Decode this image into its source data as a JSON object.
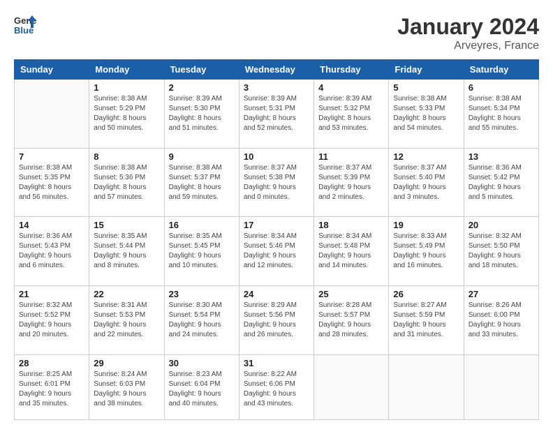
{
  "header": {
    "logo_line1": "General",
    "logo_line2": "Blue",
    "month_title": "January 2024",
    "location": "Arveyres, France"
  },
  "days_of_week": [
    "Sunday",
    "Monday",
    "Tuesday",
    "Wednesday",
    "Thursday",
    "Friday",
    "Saturday"
  ],
  "weeks": [
    [
      {
        "day": "",
        "info": ""
      },
      {
        "day": "1",
        "info": "Sunrise: 8:38 AM\nSunset: 5:29 PM\nDaylight: 8 hours\nand 50 minutes."
      },
      {
        "day": "2",
        "info": "Sunrise: 8:39 AM\nSunset: 5:30 PM\nDaylight: 8 hours\nand 51 minutes."
      },
      {
        "day": "3",
        "info": "Sunrise: 8:39 AM\nSunset: 5:31 PM\nDaylight: 8 hours\nand 52 minutes."
      },
      {
        "day": "4",
        "info": "Sunrise: 8:39 AM\nSunset: 5:32 PM\nDaylight: 8 hours\nand 53 minutes."
      },
      {
        "day": "5",
        "info": "Sunrise: 8:38 AM\nSunset: 5:33 PM\nDaylight: 8 hours\nand 54 minutes."
      },
      {
        "day": "6",
        "info": "Sunrise: 8:38 AM\nSunset: 5:34 PM\nDaylight: 8 hours\nand 55 minutes."
      }
    ],
    [
      {
        "day": "7",
        "info": "Sunrise: 8:38 AM\nSunset: 5:35 PM\nDaylight: 8 hours\nand 56 minutes."
      },
      {
        "day": "8",
        "info": "Sunrise: 8:38 AM\nSunset: 5:36 PM\nDaylight: 8 hours\nand 57 minutes."
      },
      {
        "day": "9",
        "info": "Sunrise: 8:38 AM\nSunset: 5:37 PM\nDaylight: 8 hours\nand 59 minutes."
      },
      {
        "day": "10",
        "info": "Sunrise: 8:37 AM\nSunset: 5:38 PM\nDaylight: 9 hours\nand 0 minutes."
      },
      {
        "day": "11",
        "info": "Sunrise: 8:37 AM\nSunset: 5:39 PM\nDaylight: 9 hours\nand 2 minutes."
      },
      {
        "day": "12",
        "info": "Sunrise: 8:37 AM\nSunset: 5:40 PM\nDaylight: 9 hours\nand 3 minutes."
      },
      {
        "day": "13",
        "info": "Sunrise: 8:36 AM\nSunset: 5:42 PM\nDaylight: 9 hours\nand 5 minutes."
      }
    ],
    [
      {
        "day": "14",
        "info": "Sunrise: 8:36 AM\nSunset: 5:43 PM\nDaylight: 9 hours\nand 6 minutes."
      },
      {
        "day": "15",
        "info": "Sunrise: 8:35 AM\nSunset: 5:44 PM\nDaylight: 9 hours\nand 8 minutes."
      },
      {
        "day": "16",
        "info": "Sunrise: 8:35 AM\nSunset: 5:45 PM\nDaylight: 9 hours\nand 10 minutes."
      },
      {
        "day": "17",
        "info": "Sunrise: 8:34 AM\nSunset: 5:46 PM\nDaylight: 9 hours\nand 12 minutes."
      },
      {
        "day": "18",
        "info": "Sunrise: 8:34 AM\nSunset: 5:48 PM\nDaylight: 9 hours\nand 14 minutes."
      },
      {
        "day": "19",
        "info": "Sunrise: 8:33 AM\nSunset: 5:49 PM\nDaylight: 9 hours\nand 16 minutes."
      },
      {
        "day": "20",
        "info": "Sunrise: 8:32 AM\nSunset: 5:50 PM\nDaylight: 9 hours\nand 18 minutes."
      }
    ],
    [
      {
        "day": "21",
        "info": "Sunrise: 8:32 AM\nSunset: 5:52 PM\nDaylight: 9 hours\nand 20 minutes."
      },
      {
        "day": "22",
        "info": "Sunrise: 8:31 AM\nSunset: 5:53 PM\nDaylight: 9 hours\nand 22 minutes."
      },
      {
        "day": "23",
        "info": "Sunrise: 8:30 AM\nSunset: 5:54 PM\nDaylight: 9 hours\nand 24 minutes."
      },
      {
        "day": "24",
        "info": "Sunrise: 8:29 AM\nSunset: 5:56 PM\nDaylight: 9 hours\nand 26 minutes."
      },
      {
        "day": "25",
        "info": "Sunrise: 8:28 AM\nSunset: 5:57 PM\nDaylight: 9 hours\nand 28 minutes."
      },
      {
        "day": "26",
        "info": "Sunrise: 8:27 AM\nSunset: 5:59 PM\nDaylight: 9 hours\nand 31 minutes."
      },
      {
        "day": "27",
        "info": "Sunrise: 8:26 AM\nSunset: 6:00 PM\nDaylight: 9 hours\nand 33 minutes."
      }
    ],
    [
      {
        "day": "28",
        "info": "Sunrise: 8:25 AM\nSunset: 6:01 PM\nDaylight: 9 hours\nand 35 minutes."
      },
      {
        "day": "29",
        "info": "Sunrise: 8:24 AM\nSunset: 6:03 PM\nDaylight: 9 hours\nand 38 minutes."
      },
      {
        "day": "30",
        "info": "Sunrise: 8:23 AM\nSunset: 6:04 PM\nDaylight: 9 hours\nand 40 minutes."
      },
      {
        "day": "31",
        "info": "Sunrise: 8:22 AM\nSunset: 6:06 PM\nDaylight: 9 hours\nand 43 minutes."
      },
      {
        "day": "",
        "info": ""
      },
      {
        "day": "",
        "info": ""
      },
      {
        "day": "",
        "info": ""
      }
    ]
  ]
}
